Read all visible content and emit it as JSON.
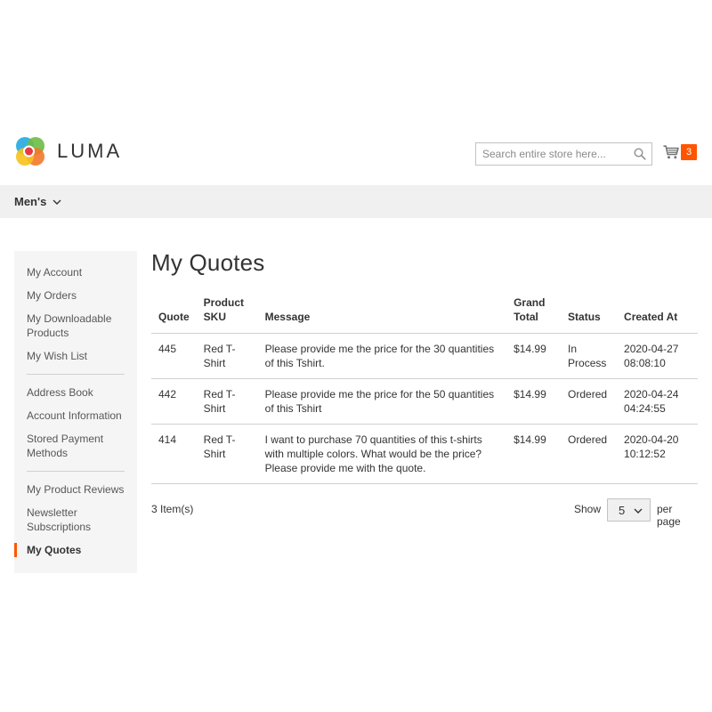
{
  "header": {
    "logo_text": "LUMA",
    "search_placeholder": "Search entire store here...",
    "cart_count": "3"
  },
  "nav": {
    "items": [
      {
        "label": "Men's"
      }
    ]
  },
  "sidebar": {
    "groups": [
      [
        "My Account",
        "My Orders",
        "My Downloadable Products",
        "My Wish List"
      ],
      [
        "Address Book",
        "Account Information",
        "Stored Payment Methods"
      ],
      [
        "My Product Reviews",
        "Newsletter Subscriptions",
        "My Quotes"
      ]
    ],
    "active": "My Quotes"
  },
  "main": {
    "title": "My Quotes",
    "columns": [
      "Quote",
      "Product SKU",
      "Message",
      "Grand Total",
      "Status",
      "Created At"
    ],
    "rows": [
      {
        "quote": "445",
        "sku": "Red T-Shirt",
        "message": "Please provide me the price for the 30 quantities of this Tshirt.",
        "total": "$14.99",
        "status": "In Process",
        "created": "2020-04-27 08:08:10"
      },
      {
        "quote": "442",
        "sku": "Red T-Shirt",
        "message": "Please provide me the price for the 50 quantities of this Tshirt",
        "total": "$14.99",
        "status": "Ordered",
        "created": "2020-04-24 04:24:55"
      },
      {
        "quote": "414",
        "sku": "Red T-Shirt",
        "message": "I want to purchase 70 quantities of this t-shirts with multiple colors. What would be the price? Please provide me with the quote.",
        "total": "$14.99",
        "status": "Ordered",
        "created": "2020-04-20 10:12:52"
      }
    ]
  },
  "toolbar": {
    "items_count": "3 Item(s)",
    "show_label": "Show",
    "limit_value": "5",
    "per_page_label": "per page"
  },
  "colors": {
    "accent": "#ff5501",
    "nav_bg": "#f0f0f0",
    "sidebar_bg": "#f5f5f5"
  }
}
